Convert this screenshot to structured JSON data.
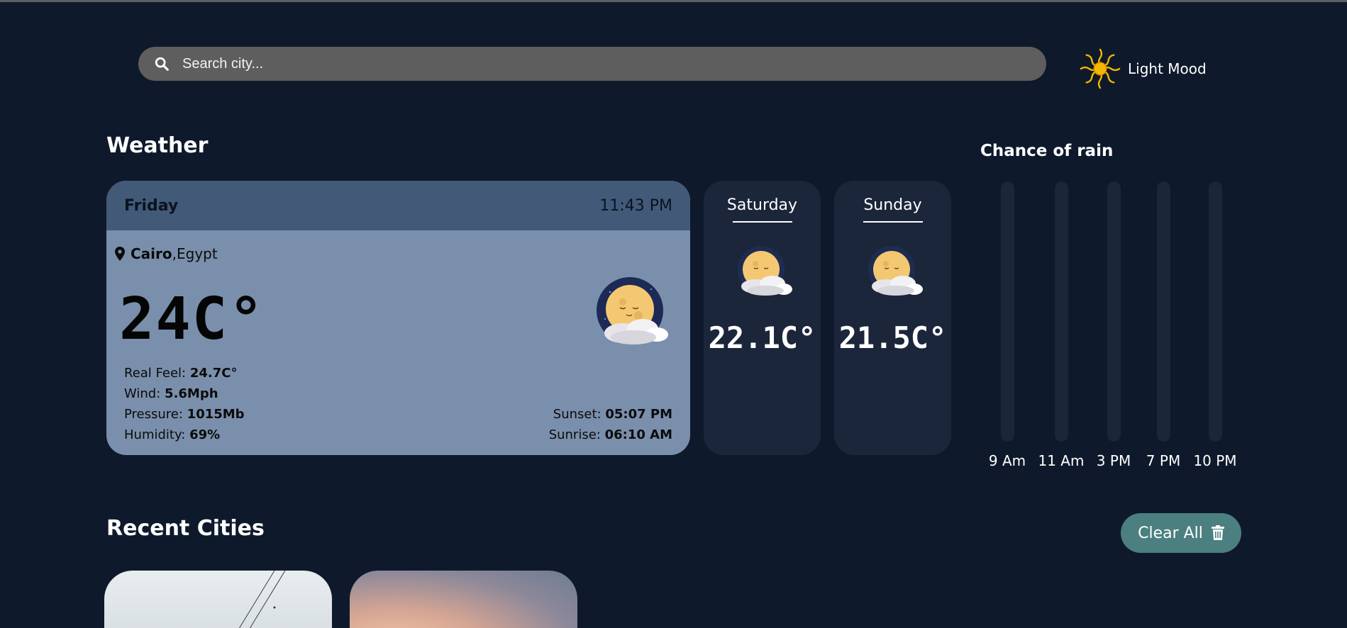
{
  "search": {
    "placeholder": "Search city..."
  },
  "theme_toggle": {
    "label": "Light Mood"
  },
  "weather_section": {
    "title": "Weather"
  },
  "today": {
    "day": "Friday",
    "time": "11:43 PM",
    "city": "Cairo",
    "country": "Egypt",
    "temperature": "24C°",
    "real_feel_label": "Real Feel:",
    "real_feel": "24.7C°",
    "wind_label": "Wind:",
    "wind": "5.6Mph",
    "pressure_label": "Pressure:",
    "pressure": "1015Mb",
    "humidity_label": "Humidity:",
    "humidity": "69%",
    "sunset_label": "Sunset:",
    "sunset": "05:07 PM",
    "sunrise_label": "Sunrise:",
    "sunrise": "06:10 AM",
    "icon": "moon-cloud-icon"
  },
  "forecast": [
    {
      "day": "Saturday",
      "temperature": "22.1C°",
      "icon": "moon-cloud-icon"
    },
    {
      "day": "Sunday",
      "temperature": "21.5C°",
      "icon": "moon-cloud-icon"
    }
  ],
  "rain": {
    "title": "Chance of rain",
    "hours": [
      "9 Am",
      "11 Am",
      "3 PM",
      "7 PM",
      "10 PM"
    ],
    "chance": [
      0,
      0,
      0,
      0,
      0
    ],
    "fill_color": "#4f7f88",
    "track_color": "#1b2638"
  },
  "recent": {
    "title": "Recent Cities",
    "clear_label": "Clear All"
  },
  "colors": {
    "background": "#0e1a2b",
    "today_card": "#7a8fac",
    "today_header": "#425a78",
    "forecast_card": "#1b263b",
    "search_bar": "#5e5e5e",
    "clear_button": "#4c7f7f",
    "sun_icon": "#f5b800"
  }
}
